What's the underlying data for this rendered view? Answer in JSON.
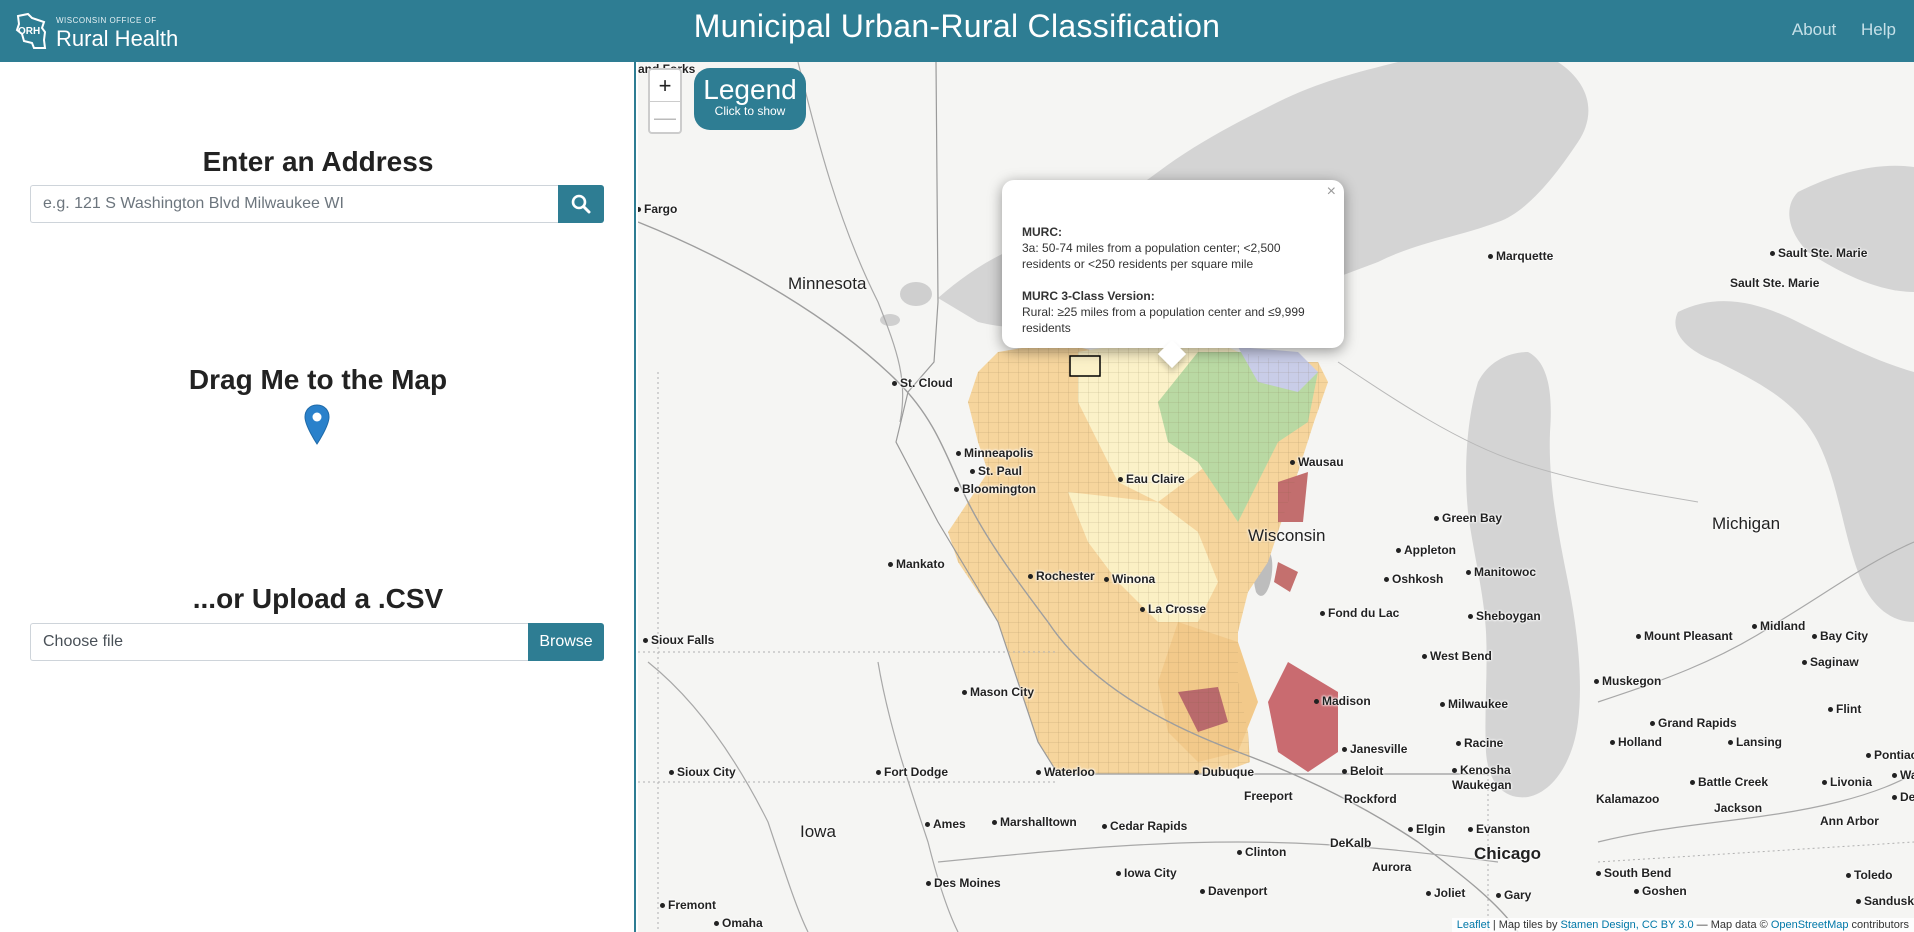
{
  "navbar": {
    "brand_small": "WISCONSIN OFFICE OF",
    "brand_big": "Rural Health",
    "title": "Municipal Urban-Rural Classification",
    "links": [
      "About",
      "Help"
    ]
  },
  "sidebar": {
    "address_heading": "Enter an Address",
    "address_placeholder": "e.g. 121 S Washington Blvd Milwaukee WI",
    "drag_heading": "Drag Me to the Map",
    "upload_heading": "...or Upload a .CSV",
    "file_label": "Choose file",
    "browse_label": "Browse"
  },
  "map": {
    "zoom_in": "+",
    "zoom_out": "—",
    "legend_title": "Legend",
    "legend_subtitle": "Click to show",
    "popup": {
      "close": "×",
      "murc_label": "MURC:",
      "murc_value": "3a: 50-74 miles from a population center; <2,500 residents or <250 residents per square mile",
      "murc3_label": "MURC 3-Class Version:",
      "murc3_value": "Rural: ≥25 miles from a population center and ≤9,999 residents"
    },
    "states": [
      "Minnesota",
      "Wisconsin",
      "Michigan",
      "Iowa"
    ],
    "cities": [
      "Fargo",
      "St. Cloud",
      "Minneapolis",
      "St. Paul",
      "Bloomington",
      "Eau Claire",
      "Wausau",
      "Green Bay",
      "Appleton",
      "Oshkosh",
      "Manitowoc",
      "Sheboygan",
      "Fond du Lac",
      "West Bend",
      "Milwaukee",
      "Racine",
      "Kenosha",
      "Waukegan",
      "Madison",
      "Janesville",
      "Beloit",
      "La Crosse",
      "Winona",
      "Rochester",
      "Mankato",
      "Sioux Falls",
      "Mason City",
      "Sioux City",
      "Fort Dodge",
      "Waterloo",
      "Dubuque",
      "Freeport",
      "Rockford",
      "Ames",
      "Marshalltown",
      "Cedar Rapids",
      "Clinton",
      "DeKalb",
      "Elgin",
      "Evanston",
      "Chicago",
      "Aurora",
      "Iowa City",
      "Davenport",
      "Des Moines",
      "Joliet",
      "Gary",
      "Fremont",
      "Omaha",
      "Marquette",
      "Sault Ste. Marie",
      "Sault Ste. Marie",
      "Mount Pleasant",
      "Midland",
      "Bay City",
      "Saginaw",
      "Muskegon",
      "Flint",
      "Grand Rapids",
      "Holland",
      "Lansing",
      "Pontiac",
      "Battle Creek",
      "Livonia",
      "Kalamazoo",
      "Jackson",
      "Ann Arbor",
      "South Bend",
      "Goshen",
      "Toledo",
      "Sandusky",
      "Wa",
      "Detr",
      "and Forks"
    ],
    "attribution": {
      "leaflet": "Leaflet",
      "text1": " | Map tiles by ",
      "stamen": "Stamen Design, CC BY 3.0",
      "text2": " — Map data © ",
      "osm": "OpenStreetMap",
      "text3": " contributors"
    }
  }
}
